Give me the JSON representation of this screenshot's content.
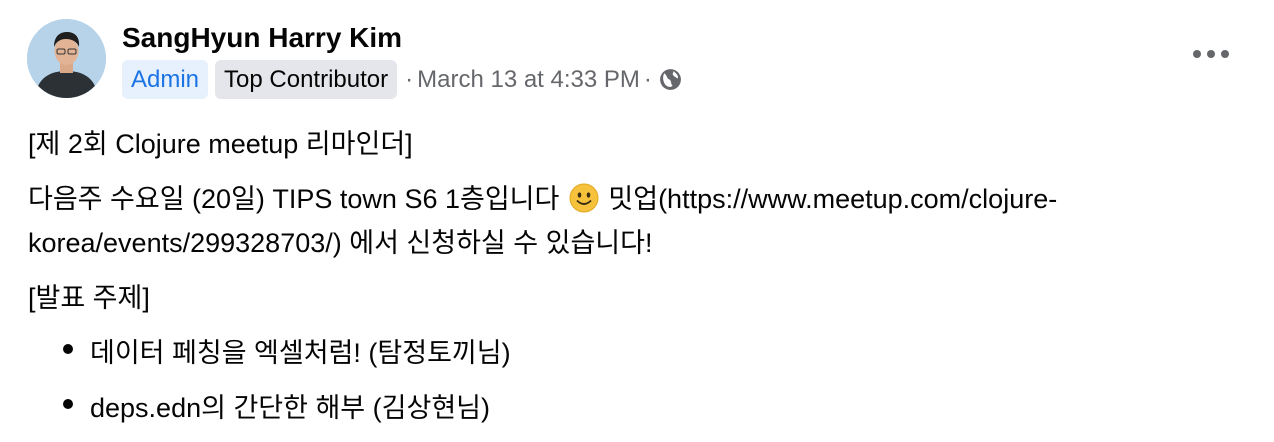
{
  "post": {
    "author": "SangHyun Harry Kim",
    "badges": {
      "admin": "Admin",
      "top_contributor": "Top Contributor"
    },
    "separator": "·",
    "timestamp": "March 13 at 4:33 PM",
    "privacy_icon": "globe-icon",
    "menu_icon": "more-horizontal-icon",
    "body": {
      "title": "[제 2회 Clojure meetup 리마인더]",
      "line1_before_emoji": "다음주 수요일 (20일) TIPS town S6 1층입니다",
      "emoji": "slightly-smiling-face-emoji",
      "line1_after_emoji": "밋업(https://www.meetup.com/clojure-",
      "line2": "korea/events/299328703/) 에서 신청하실 수 있습니다!",
      "topics_heading": "[발표 주제]",
      "topics": [
        "데이터 페칭을 엑셀처럼! (탐정토끼님)",
        "deps.edn의 간단한 해부 (김상현님)"
      ]
    }
  },
  "colors": {
    "text": "#050505",
    "secondary": "#65676b",
    "admin_badge_bg": "#e7f0fd",
    "admin_badge_text": "#1b74e4",
    "top_badge_bg": "#e4e6eb"
  }
}
